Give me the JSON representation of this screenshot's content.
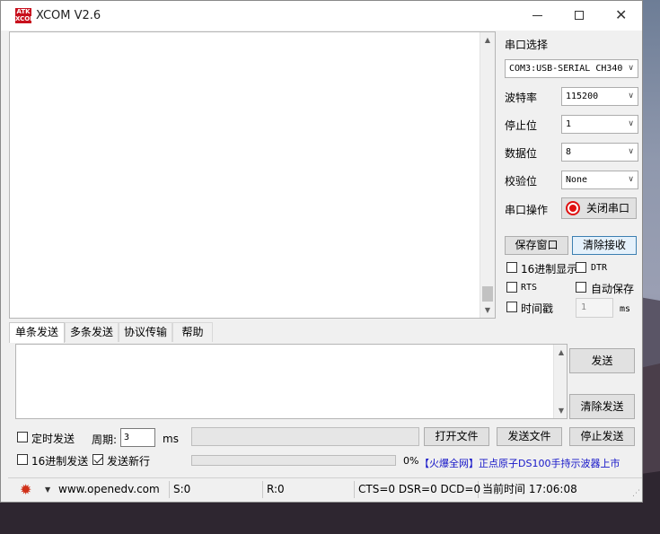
{
  "window": {
    "title": "XCOM V2.6",
    "logo_text": [
      "ATK",
      "XCOM"
    ]
  },
  "serial": {
    "port_label": "串口选择",
    "port_value": "COM3:USB-SERIAL CH340",
    "baud_label": "波特率",
    "baud_value": "115200",
    "stop_label": "停止位",
    "stop_value": "1",
    "data_label": "数据位",
    "data_value": "8",
    "parity_label": "校验位",
    "parity_value": "None",
    "op_label": "串口操作",
    "close_button": "关闭串口"
  },
  "receive": {
    "save_window": "保存窗口",
    "clear_receive": "清除接收",
    "hex_display": "16进制显示",
    "dtr": "DTR",
    "rts": "RTS",
    "auto_save": "自动保存",
    "timestamp": "时间戳",
    "timestamp_value": "1",
    "timestamp_unit": "ms"
  },
  "tabs": [
    "单条发送",
    "多条发送",
    "协议传输",
    "帮助"
  ],
  "send": {
    "send_button": "发送",
    "clear_send": "清除发送",
    "timed_send": "定时发送",
    "period_label": "周期:",
    "period_value": "3",
    "period_unit": "ms",
    "open_file": "打开文件",
    "send_file": "发送文件",
    "stop_send": "停止发送",
    "hex_send": "16进制发送",
    "send_newline": "发送新行",
    "newline_checked": true,
    "progress_percent": "0%",
    "ad_text": "【火爆全网】正点原子DS100手持示波器上市"
  },
  "status": {
    "url": "www.openedv.com",
    "sent": "S:0",
    "received": "R:0",
    "signals": "CTS=0 DSR=0 DCD=0",
    "time": "当前时间 17:06:08"
  },
  "icons": {
    "gear": "gear-icon",
    "close_dot": "red-dot-icon"
  }
}
